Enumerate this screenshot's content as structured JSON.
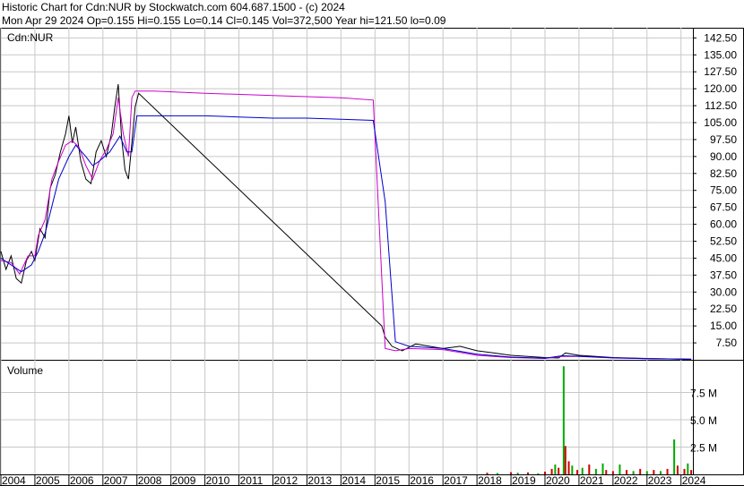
{
  "header": {
    "line1": "Historic Chart for Cdn:NUR by Stockwatch.com 604.687.1500 - (c) 2024",
    "line2": "Mon Apr 29 2024   Op=0.155  Hi=0.155  Lo=0.14  Cl=0.145  Vol=372,500  Year hi=121.50  lo=0.09"
  },
  "chart_data": [
    {
      "type": "line",
      "title": "Cdn:NUR",
      "x_unit": "year",
      "xlim": [
        2004.0,
        2024.35
      ],
      "ylim": [
        0,
        147
      ],
      "y_ticks": [
        "142.50",
        "135.00",
        "127.50",
        "120.00",
        "112.50",
        "105.00",
        "97.50",
        "90.00",
        "82.50",
        "75.00",
        "67.50",
        "60.00",
        "52.50",
        "45.00",
        "37.50",
        "30.00",
        "22.50",
        "15.00",
        "7.50"
      ],
      "x_ticks": [
        "2004",
        "2005",
        "2006",
        "2007",
        "2008",
        "2009",
        "2010",
        "2011",
        "2012",
        "2013",
        "2014",
        "2015",
        "2016",
        "2017",
        "2018",
        "2019",
        "2020",
        "2021",
        "2022",
        "2023",
        "2024"
      ],
      "grid": true,
      "series": [
        {
          "color": "#cc00cc",
          "points": [
            [
              2004.0,
              44
            ],
            [
              2004.3,
              43
            ],
            [
              2004.55,
              38
            ],
            [
              2004.8,
              46
            ],
            [
              2005.0,
              46
            ],
            [
              2005.1,
              55
            ],
            [
              2005.3,
              62
            ],
            [
              2005.5,
              80
            ],
            [
              2005.7,
              88
            ],
            [
              2005.9,
              95
            ],
            [
              2006.1,
              97
            ],
            [
              2006.3,
              94
            ],
            [
              2006.5,
              86
            ],
            [
              2006.7,
              80
            ],
            [
              2006.9,
              88
            ],
            [
              2007.1,
              93
            ],
            [
              2007.3,
              100
            ],
            [
              2007.45,
              116
            ],
            [
              2007.6,
              100
            ],
            [
              2007.75,
              90
            ],
            [
              2007.85,
              116
            ],
            [
              2007.95,
              119
            ],
            [
              2008.5,
              119
            ],
            [
              2010.0,
              118
            ],
            [
              2012.0,
              117
            ],
            [
              2014.0,
              116
            ],
            [
              2014.95,
              115
            ],
            [
              2015.3,
              5
            ],
            [
              2015.6,
              4
            ],
            [
              2016.0,
              5
            ],
            [
              2017.0,
              4.5
            ],
            [
              2018.0,
              2
            ],
            [
              2019.0,
              1
            ],
            [
              2020.0,
              0.6
            ],
            [
              2020.5,
              1.5
            ],
            [
              2021.0,
              1.5
            ],
            [
              2022.0,
              0.8
            ],
            [
              2023.0,
              0.5
            ],
            [
              2024.3,
              0.3
            ]
          ]
        },
        {
          "color": "#0000cc",
          "points": [
            [
              2004.0,
              45
            ],
            [
              2004.3,
              42
            ],
            [
              2004.6,
              39
            ],
            [
              2004.9,
              42
            ],
            [
              2005.1,
              48
            ],
            [
              2005.3,
              56
            ],
            [
              2005.5,
              68
            ],
            [
              2005.7,
              80
            ],
            [
              2006.0,
              90
            ],
            [
              2006.2,
              95
            ],
            [
              2006.5,
              90
            ],
            [
              2006.7,
              86
            ],
            [
              2006.9,
              88
            ],
            [
              2007.2,
              92
            ],
            [
              2007.5,
              99
            ],
            [
              2007.7,
              92
            ],
            [
              2007.85,
              92
            ],
            [
              2008.0,
              108
            ],
            [
              2009.0,
              108
            ],
            [
              2010.0,
              108
            ],
            [
              2011.0,
              107.5
            ],
            [
              2012.0,
              107
            ],
            [
              2013.0,
              107
            ],
            [
              2014.0,
              106.5
            ],
            [
              2014.95,
              106
            ],
            [
              2015.3,
              70
            ],
            [
              2015.6,
              8
            ],
            [
              2016.0,
              6
            ],
            [
              2017.0,
              5
            ],
            [
              2018.0,
              2.5
            ],
            [
              2019.0,
              1.2
            ],
            [
              2020.0,
              0.7
            ],
            [
              2020.5,
              1.8
            ],
            [
              2021.0,
              1.6
            ],
            [
              2022.0,
              0.9
            ],
            [
              2023.0,
              0.5
            ],
            [
              2024.3,
              0.3
            ]
          ]
        },
        {
          "color": "#000000",
          "points": [
            [
              2004.0,
              48
            ],
            [
              2004.15,
              40
            ],
            [
              2004.3,
              46
            ],
            [
              2004.45,
              36
            ],
            [
              2004.6,
              34
            ],
            [
              2004.75,
              44
            ],
            [
              2004.9,
              48
            ],
            [
              2005.0,
              44
            ],
            [
              2005.15,
              58
            ],
            [
              2005.3,
              54
            ],
            [
              2005.45,
              76
            ],
            [
              2005.6,
              82
            ],
            [
              2005.75,
              92
            ],
            [
              2005.9,
              100
            ],
            [
              2006.0,
              108
            ],
            [
              2006.1,
              96
            ],
            [
              2006.2,
              103
            ],
            [
              2006.35,
              88
            ],
            [
              2006.5,
              80
            ],
            [
              2006.65,
              78
            ],
            [
              2006.8,
              92
            ],
            [
              2006.95,
              97
            ],
            [
              2007.1,
              90
            ],
            [
              2007.25,
              100
            ],
            [
              2007.35,
              112
            ],
            [
              2007.45,
              122
            ],
            [
              2007.55,
              98
            ],
            [
              2007.65,
              84
            ],
            [
              2007.75,
              80
            ],
            [
              2007.85,
              96
            ],
            [
              2007.95,
              112
            ],
            [
              2008.05,
              118
            ],
            [
              2015.2,
              15
            ],
            [
              2015.3,
              10
            ],
            [
              2015.5,
              6
            ],
            [
              2015.8,
              4
            ],
            [
              2016.2,
              7
            ],
            [
              2016.6,
              6
            ],
            [
              2017.0,
              5
            ],
            [
              2017.5,
              6
            ],
            [
              2018.0,
              4
            ],
            [
              2018.5,
              3
            ],
            [
              2019.0,
              2
            ],
            [
              2019.5,
              1.5
            ],
            [
              2020.0,
              1
            ],
            [
              2020.4,
              0.8
            ],
            [
              2020.6,
              3
            ],
            [
              2021.0,
              2
            ],
            [
              2022.0,
              1
            ],
            [
              2023.0,
              0.6
            ],
            [
              2024.3,
              0.15
            ]
          ]
        }
      ]
    },
    {
      "type": "bar",
      "title": "Volume",
      "ylim": [
        0,
        10
      ],
      "y_unit": "M shares",
      "y_ticks": [
        "7.5 M",
        "5.0 M",
        "2.5 M"
      ],
      "bars": [
        {
          "x": 2018.3,
          "v": 0.15,
          "color": "#cc0000"
        },
        {
          "x": 2018.6,
          "v": 0.12,
          "color": "#00aa00"
        },
        {
          "x": 2019.0,
          "v": 0.2,
          "color": "#cc0000"
        },
        {
          "x": 2019.2,
          "v": 0.15,
          "color": "#00aa00"
        },
        {
          "x": 2019.5,
          "v": 0.18,
          "color": "#cc0000"
        },
        {
          "x": 2019.8,
          "v": 0.1,
          "color": "#00aa00"
        },
        {
          "x": 2020.0,
          "v": 0.25,
          "color": "#cc0000"
        },
        {
          "x": 2020.2,
          "v": 0.5,
          "color": "#cc0000"
        },
        {
          "x": 2020.3,
          "v": 0.9,
          "color": "#00aa00"
        },
        {
          "x": 2020.4,
          "v": 0.6,
          "color": "#cc0000"
        },
        {
          "x": 2020.55,
          "v": 9.9,
          "color": "#00aa00"
        },
        {
          "x": 2020.6,
          "v": 2.6,
          "color": "#cc0000"
        },
        {
          "x": 2020.7,
          "v": 1.2,
          "color": "#cc0000"
        },
        {
          "x": 2020.8,
          "v": 0.8,
          "color": "#00aa00"
        },
        {
          "x": 2020.95,
          "v": 0.4,
          "color": "#cc0000"
        },
        {
          "x": 2021.1,
          "v": 0.6,
          "color": "#00aa00"
        },
        {
          "x": 2021.3,
          "v": 0.9,
          "color": "#cc0000"
        },
        {
          "x": 2021.5,
          "v": 0.5,
          "color": "#00aa00"
        },
        {
          "x": 2021.7,
          "v": 1.0,
          "color": "#00aa00"
        },
        {
          "x": 2021.8,
          "v": 0.4,
          "color": "#cc0000"
        },
        {
          "x": 2022.0,
          "v": 0.3,
          "color": "#cc0000"
        },
        {
          "x": 2022.2,
          "v": 0.9,
          "color": "#00aa00"
        },
        {
          "x": 2022.4,
          "v": 0.4,
          "color": "#cc0000"
        },
        {
          "x": 2022.6,
          "v": 0.3,
          "color": "#00aa00"
        },
        {
          "x": 2022.8,
          "v": 0.5,
          "color": "#cc0000"
        },
        {
          "x": 2023.0,
          "v": 0.3,
          "color": "#00aa00"
        },
        {
          "x": 2023.2,
          "v": 0.4,
          "color": "#cc0000"
        },
        {
          "x": 2023.4,
          "v": 0.3,
          "color": "#00aa00"
        },
        {
          "x": 2023.6,
          "v": 0.5,
          "color": "#cc0000"
        },
        {
          "x": 2023.8,
          "v": 3.2,
          "color": "#00aa00"
        },
        {
          "x": 2023.9,
          "v": 0.8,
          "color": "#cc0000"
        },
        {
          "x": 2024.1,
          "v": 0.5,
          "color": "#cc0000"
        },
        {
          "x": 2024.2,
          "v": 1.0,
          "color": "#00aa00"
        },
        {
          "x": 2024.3,
          "v": 0.4,
          "color": "#cc0000"
        }
      ]
    }
  ]
}
